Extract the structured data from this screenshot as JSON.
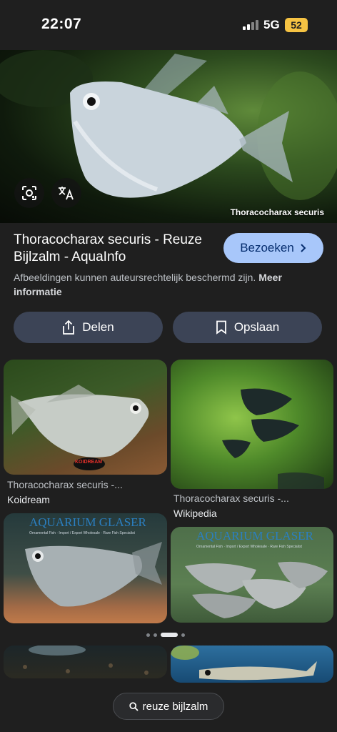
{
  "status": {
    "time": "22:07",
    "network": "5G",
    "battery": "52"
  },
  "hero": {
    "caption": "Thoracocharax securis"
  },
  "result": {
    "title": "Thoracocharax securis - Reuze Bijlzalm - AquaInfo",
    "visit_label": "Bezoeken",
    "notice_text": "Afbeeldingen kunnen auteursrechtelijk beschermd zijn.",
    "notice_link": "Meer informatie"
  },
  "actions": {
    "share_label": "Delen",
    "save_label": "Opslaan"
  },
  "related": [
    {
      "title": "Thoracocharax securis -...",
      "source": "Koidream",
      "watermark": "KOIDREAM"
    },
    {
      "title": "Thoracocharax securis -...",
      "source": "Wikipedia"
    },
    {
      "watermark": "AQUARIUM GLASER",
      "watermark_sub": "Ornamental Fish · Import / Export Wholesale · Rare Fish Specialist"
    },
    {
      "watermark": "AQUARIUM GLASER",
      "watermark_sub": "Ornamental Fish · Import / Export Wholesale · Rare Fish Specialist"
    }
  ],
  "search": {
    "query": "reuze bijlzalm"
  },
  "colors": {
    "accent": "#a8c7fa",
    "button_bg": "#3c4456",
    "page_bg": "#1f1f1f"
  }
}
